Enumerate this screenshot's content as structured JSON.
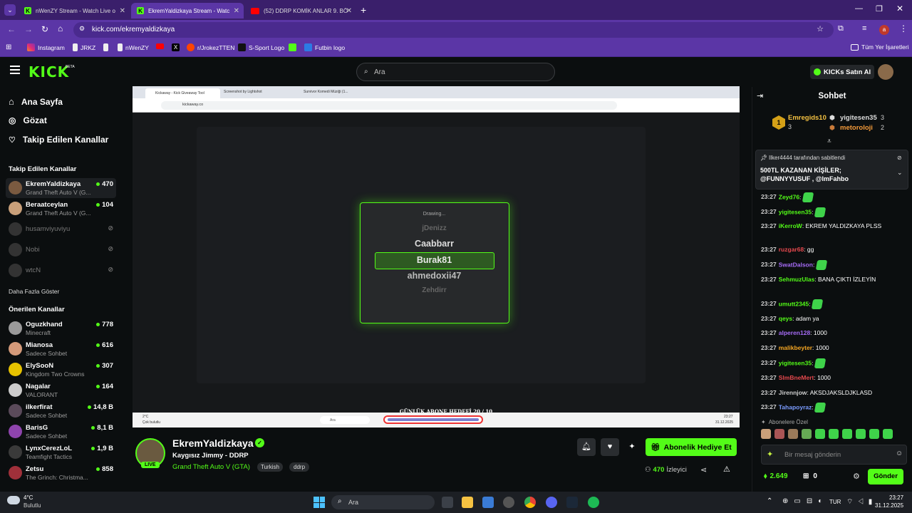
{
  "browser": {
    "tabs": [
      {
        "title": "nWenZY Stream - Watch Live o"
      },
      {
        "title": "EkremYaldizkaya Stream - Watc"
      },
      {
        "title": "(52) DDRP KOMİK ANLAR 9. BÖ"
      }
    ],
    "url": "kick.com/ekremyaldizkaya",
    "profile_letter": "a",
    "bookmarks": [
      "Instagram",
      "JRKZ",
      "nWenZY",
      "r/JrokezTTEN",
      "S-Sport Logo",
      "Futbin logo"
    ],
    "all_bookmarks": "Tüm Yer İşaretleri"
  },
  "header": {
    "logo": "KICK",
    "logo_beta": "BETA",
    "search_placeholder": "Ara",
    "kicks_button": "KICKs Satın Al"
  },
  "sidebar": {
    "nav": [
      {
        "label": "Ana Sayfa",
        "icon": "home-icon"
      },
      {
        "label": "Gözat",
        "icon": "compass-icon"
      },
      {
        "label": "Takip Edilen Kanallar",
        "icon": "heart-icon"
      }
    ],
    "followed_title": "Takip Edilen Kanallar",
    "followed": [
      {
        "name": "EkremYaldizkaya",
        "game": "Grand Theft Auto V (G...",
        "viewers": "470"
      },
      {
        "name": "Beraatceylan",
        "game": "Grand Theft Auto V (G...",
        "viewers": "104"
      },
      {
        "name": "husamviyuviyu"
      },
      {
        "name": "Nobi"
      },
      {
        "name": "wtcN"
      }
    ],
    "show_more": "Daha Fazla Göster",
    "recommended_title": "Önerilen Kanallar",
    "recommended": [
      {
        "name": "Oguzkhand",
        "game": "Minecraft",
        "viewers": "778"
      },
      {
        "name": "Mianosa",
        "game": "Sadece Sohbet",
        "viewers": "616"
      },
      {
        "name": "ElySooN",
        "game": "Kingdom Two Crowns",
        "viewers": "307"
      },
      {
        "name": "Nagalar",
        "game": "VALORANT",
        "viewers": "164"
      },
      {
        "name": "ilkerfirat",
        "game": "Sadece Sohbet",
        "viewers": "14,8 B"
      },
      {
        "name": "BarisG",
        "game": "Sadece Sohbet",
        "viewers": "8,1 B"
      },
      {
        "name": "LynxCerezLoL",
        "game": "Teamfight Tactics",
        "viewers": "1,9 B"
      },
      {
        "name": "Zetsu",
        "game": "The Grinch: Christma...",
        "viewers": "858"
      }
    ]
  },
  "video": {
    "inner_tabs": [
      "Kickaway - Kick Giveaway Tool",
      "Screenshot by Lightshot",
      "Survivor Komedi Müziği (1..."
    ],
    "inner_url": "kickaway.co",
    "modal_title": "Drawing...",
    "names": [
      "jDenizz",
      "Caabbarr",
      "Burak81",
      "ahmedoxii47",
      "Zehdirr"
    ],
    "selected": "Burak81",
    "goal_text": "GÜNLÜK ABONE HEDEFİ   20 / 10",
    "inner_weather": "2°C",
    "inner_weather_sub": "Çok bulutlu",
    "inner_search": "Ara",
    "inner_time": "23:27",
    "inner_date": "31.12.2025"
  },
  "stream": {
    "channel": "EkremYaldizkaya",
    "title": "Kaygısız Jimmy - DDRP",
    "category": "Grand Theft Auto V (GTA)",
    "tags": [
      "Turkish",
      "ddrp"
    ],
    "live_badge": "LIVE",
    "gift_button": "Abonelik Hediye Et",
    "viewers": "470",
    "viewers_label": "İzleyici"
  },
  "chat": {
    "title": "Sohbet",
    "leaders": [
      {
        "rank": "1",
        "name": "Emregids10",
        "count": "3"
      },
      {
        "name": "yigitesen35",
        "count": "3"
      },
      {
        "name": "metoroloji",
        "count": "2"
      }
    ],
    "pinned_by": "Ilker4444 tarafından sabitlendi",
    "pinned_text": "500TL KAZANAN KİŞİLER; @FUNNYYUSUF , @ImFahbo",
    "messages": [
      {
        "time": "23:27",
        "user": "Zeyd76",
        "color": "#53fc18",
        "text": "",
        "emote": true
      },
      {
        "time": "23:27",
        "user": "yigitesen35",
        "color": "#53fc18",
        "text": "",
        "emote": true
      },
      {
        "time": "23:27",
        "user": "iKerroW",
        "color": "#53fc18",
        "text": "EKREM YALDIZKAYA PLSS"
      },
      {
        "time": "23:27",
        "user": "ruzgar68",
        "color": "#e5484d",
        "text": "gg"
      },
      {
        "time": "23:27",
        "user": "SwatDalson",
        "color": "#a56bf5",
        "text": "",
        "emote": true
      },
      {
        "time": "23:27",
        "user": "SehmuzUlas",
        "color": "#53fc18",
        "text": "BANA ÇIKTI İZLEYİN"
      },
      {
        "time": "23:27",
        "user": "umutt2345",
        "color": "#53fc18",
        "text": "",
        "emote": true
      },
      {
        "time": "23:27",
        "user": "qeys",
        "color": "#53fc18",
        "text": "adam ya"
      },
      {
        "time": "23:27",
        "user": "alperen128",
        "color": "#a56bf5",
        "text": "1000"
      },
      {
        "time": "23:27",
        "user": "malikbeyter",
        "color": "#f5a623",
        "text": "1000"
      },
      {
        "time": "23:27",
        "user": "yigitesen35",
        "color": "#53fc18",
        "text": "",
        "emote": true
      },
      {
        "time": "23:27",
        "user": "SlmBneMert",
        "color": "#e5484d",
        "text": "1000"
      },
      {
        "time": "23:27",
        "user": "Jirennjow",
        "color": "#cfcfcf",
        "text": "AKSDJAKSLDJKLASD"
      },
      {
        "time": "23:27",
        "user": "Tahapoyraz",
        "color": "#7b9cff",
        "text": "",
        "emote": true
      }
    ],
    "subs_label": "Abonelere Özel",
    "input_placeholder": "Bir mesaj gönderin",
    "points": "2.649",
    "gifts": "0",
    "send_button": "Gönder"
  },
  "taskbar": {
    "weather_temp": "4°C",
    "weather_desc": "Bulutlu",
    "search": "Ara",
    "lang": "TUR",
    "time": "23:27",
    "date": "31.12.2025"
  }
}
